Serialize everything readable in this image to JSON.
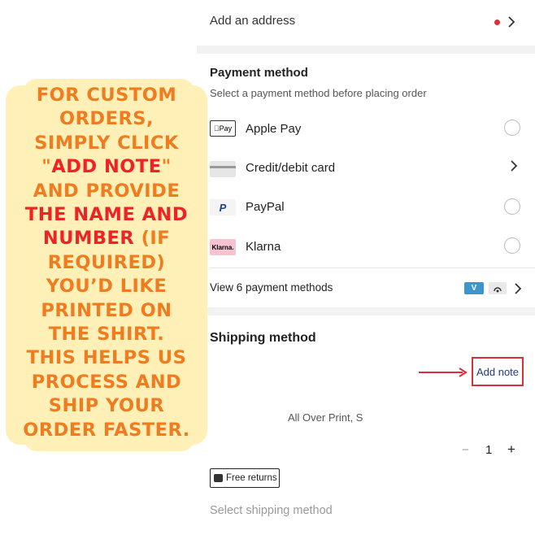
{
  "address": {
    "label": "Add an address"
  },
  "payment": {
    "title": "Payment method",
    "subtitle": "Select a payment method before placing order",
    "methods": [
      {
        "label": "Apple Pay",
        "icon_text": "Pay",
        "control": "radio"
      },
      {
        "label": "Credit/debit card",
        "icon_text": "",
        "control": "chevron"
      },
      {
        "label": "PayPal",
        "icon_text": "P",
        "control": "radio"
      },
      {
        "label": "Klarna",
        "icon_text": "Klarna.",
        "control": "radio"
      }
    ],
    "view_more": "View 6 payment methods",
    "badge_v": "V"
  },
  "shipping": {
    "title": "Shipping method",
    "add_note": "Add note",
    "product": "All Over Print, S",
    "quantity": "1",
    "minus": "−",
    "plus": "+",
    "free_returns": "Free returns",
    "select_shipping": "Select shipping method"
  },
  "callout": {
    "lines": [
      [
        {
          "t": "FOR CUSTOM"
        }
      ],
      [
        {
          "t": "ORDERS,"
        }
      ],
      [
        {
          "t": "SIMPLY CLICK"
        }
      ],
      [
        {
          "t": "\""
        },
        {
          "t": "ADD NOTE",
          "red": true
        },
        {
          "t": "\""
        }
      ],
      [
        {
          "t": "AND PROVIDE"
        }
      ],
      [
        {
          "t": "THE NAME AND",
          "red": true
        }
      ],
      [
        {
          "t": "NUMBER",
          "red": true
        },
        {
          "t": " (IF"
        }
      ],
      [
        {
          "t": "REQUIRED)"
        }
      ],
      [
        {
          "t": "YOU’D LIKE"
        }
      ],
      [
        {
          "t": "PRINTED ON"
        }
      ],
      [
        {
          "t": "THE SHIRT."
        }
      ],
      [
        {
          "t": "THIS HELPS US"
        }
      ],
      [
        {
          "t": "PROCESS AND"
        }
      ],
      [
        {
          "t": "SHIP YOUR"
        }
      ],
      [
        {
          "t": "ORDER FASTER."
        }
      ]
    ]
  },
  "colors": {
    "accent_red": "#d9303c",
    "callout_orange": "#ef7c1f",
    "callout_bg": "#fff0b8",
    "note_blue": "#1e3a8a"
  }
}
